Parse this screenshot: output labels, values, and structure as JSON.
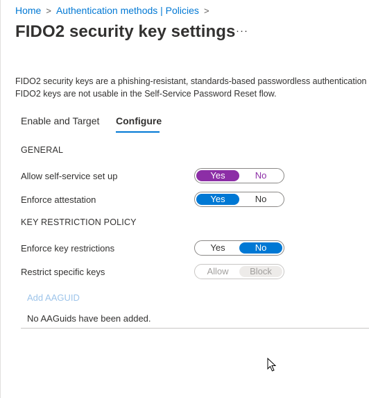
{
  "breadcrumb": {
    "items": [
      "Home",
      "Authentication methods | Policies"
    ],
    "separator": ">"
  },
  "page": {
    "title": "FIDO2 security key settings",
    "more_label": "···"
  },
  "description": {
    "line1": "FIDO2 security keys are a phishing-resistant, standards-based passwordless authentication",
    "line2": "FIDO2 keys are not usable in the Self-Service Password Reset flow."
  },
  "tabs": [
    {
      "label": "Enable and Target"
    },
    {
      "label": "Configure"
    }
  ],
  "active_tab": "Configure",
  "general": {
    "heading": "GENERAL",
    "self_service": {
      "label": "Allow self-service set up",
      "options": [
        "Yes",
        "No"
      ],
      "selected": "Yes"
    },
    "attestation": {
      "label": "Enforce attestation",
      "options": [
        "Yes",
        "No"
      ],
      "selected": "Yes"
    }
  },
  "key_restriction": {
    "heading": "KEY RESTRICTION POLICY",
    "enforce": {
      "label": "Enforce key restrictions",
      "options": [
        "Yes",
        "No"
      ],
      "selected": "No"
    },
    "restrict": {
      "label": "Restrict specific keys",
      "options": [
        "Allow",
        "Block"
      ],
      "selected": "Block",
      "disabled": true
    }
  },
  "aaguid": {
    "add_label": "Add AAGUID",
    "empty_text": "No AAGuids have been added."
  },
  "colors": {
    "accent": "#0078d4",
    "purple": "#8c2ea6",
    "text": "#323130",
    "disabled_link": "#9dc4ea"
  }
}
